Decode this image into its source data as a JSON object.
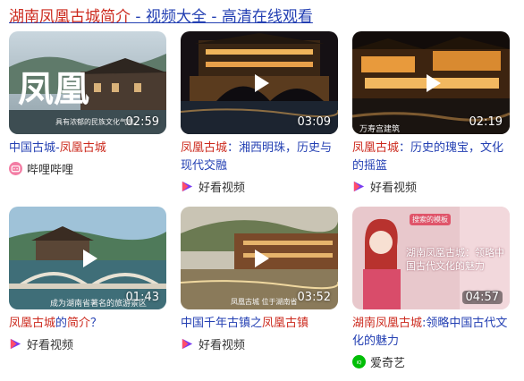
{
  "header": {
    "part1": "湖南凤凰古城简介",
    "part2": " - 视频大全 - 高清在线观看"
  },
  "cards": [
    {
      "duration": "02:59",
      "overlay_big": "凤凰",
      "overlay_caption": "具有浓郁的民族文化气息",
      "title_a": "中国古城-",
      "title_b": "凤凰古城",
      "title_c": "",
      "source": "哔哩哔哩",
      "source_icon": "bilibili-icon"
    },
    {
      "duration": "03:09",
      "title_a": "",
      "title_b": "凤凰古城",
      "title_c": "：湘西明珠，历史与现代交融",
      "source": "好看视频",
      "source_icon": "haokan-icon"
    },
    {
      "duration": "02:19",
      "overlay_caption": "万寿宫建筑",
      "title_a": "",
      "title_b": "凤凰古城",
      "title_c": "：历史的瑰宝，文化的摇篮",
      "source": "好看视频",
      "source_icon": "haokan-icon"
    },
    {
      "duration": "01:43",
      "overlay_caption": "成为湖南省著名的旅游景区",
      "title_a": "",
      "title_b": "凤凰古城",
      "title_c": "的",
      "title_d": "简介",
      "title_e": "？",
      "source": "好看视频",
      "source_icon": "haokan-icon"
    },
    {
      "duration": "03:52",
      "overlay_caption": "凤凰古城 位于湖南省",
      "title_a": "中国千年古镇之",
      "title_b": "凤凰古镇",
      "title_c": "",
      "source": "好看视频",
      "source_icon": "haokan-icon"
    },
    {
      "duration": "04:57",
      "overlay_badge": "搜索的模板",
      "overlay_caption": "湖南凤凰古城：领略中国古代文化的魅力",
      "title_a": "",
      "title_b": "湖南凤凰古城",
      "title_c": ":领略中国古代文化的魅力",
      "source": "爱奇艺",
      "source_icon": "iqiyi-icon"
    }
  ],
  "colors": {
    "link": "#2440b3",
    "highlight": "#cc2a1e",
    "source_text": "#333333"
  }
}
